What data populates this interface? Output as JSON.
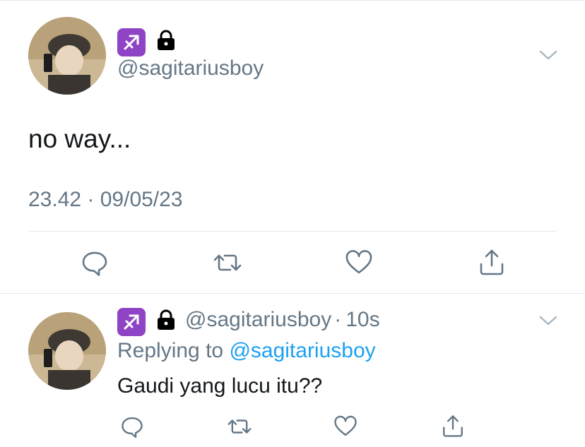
{
  "main_tweet": {
    "zodiac_icon": "sagittarius-icon",
    "lock_icon": "lock-icon",
    "handle": "@sagitariusboy",
    "text": "no way...",
    "timestamp": "23.42 · 09/05/23",
    "actions": [
      "reply-icon",
      "retweet-icon",
      "like-icon",
      "share-icon"
    ]
  },
  "reply_tweet": {
    "zodiac_icon": "sagittarius-icon",
    "lock_icon": "lock-icon",
    "handle": "@sagitariusboy",
    "dot": "·",
    "time_ago": "10s",
    "replying_prefix": "Replying to",
    "replying_handle": "@sagitariusboy",
    "text": "Gaudi yang lucu itu??",
    "actions": [
      "reply-icon",
      "retweet-icon",
      "like-icon",
      "share-icon"
    ]
  },
  "colors": {
    "secondary_text": "#657786",
    "link": "#1da1f2",
    "zodiac_badge": "#8e44c4",
    "divider": "#e1e8ed"
  }
}
